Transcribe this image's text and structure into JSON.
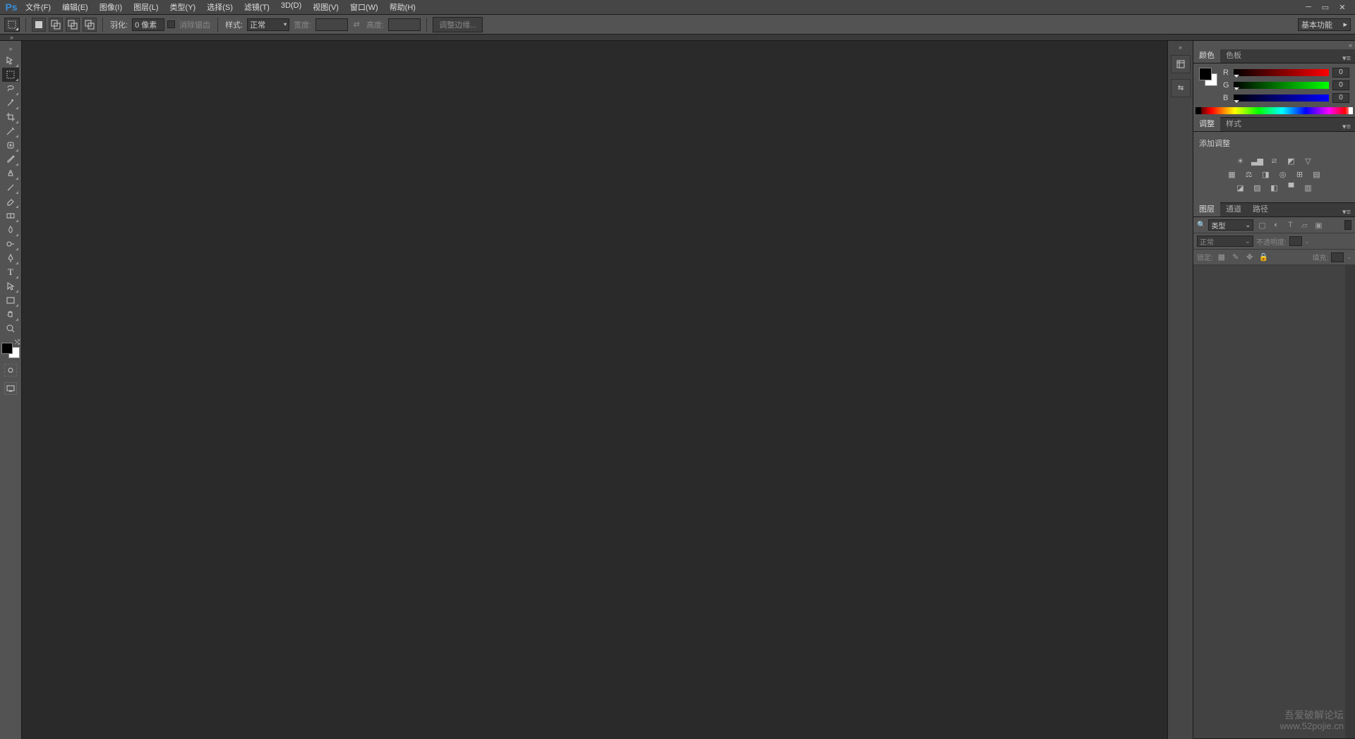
{
  "app": {
    "logo": "Ps"
  },
  "menus": [
    "文件(F)",
    "编辑(E)",
    "图像(I)",
    "图层(L)",
    "类型(Y)",
    "选择(S)",
    "滤镜(T)",
    "3D(D)",
    "视图(V)",
    "窗口(W)",
    "帮助(H)"
  ],
  "optbar": {
    "feather_label": "羽化:",
    "feather_value": "0 像素",
    "antialias": "消除锯齿",
    "style_label": "样式:",
    "style_value": "正常",
    "width_label": "宽度:",
    "height_label": "高度:",
    "refine": "调整边缘...",
    "workspace": "基本功能"
  },
  "colors": {
    "tab1": "颜色",
    "tab2": "色板",
    "r_label": "R",
    "r_val": "0",
    "g_label": "G",
    "g_val": "0",
    "b_label": "B",
    "b_val": "0"
  },
  "adjust": {
    "tab1": "调整",
    "tab2": "样式",
    "title": "添加调整"
  },
  "layers": {
    "tab1": "图层",
    "tab2": "通道",
    "tab3": "路径",
    "filter": "类型",
    "blend": "正常",
    "opacity_label": "不透明度:",
    "lock_label": "锁定:",
    "fill_label": "填充:"
  },
  "watermark": {
    "line1": "吾爱破解论坛",
    "line2": "www.52pojie.cn"
  }
}
